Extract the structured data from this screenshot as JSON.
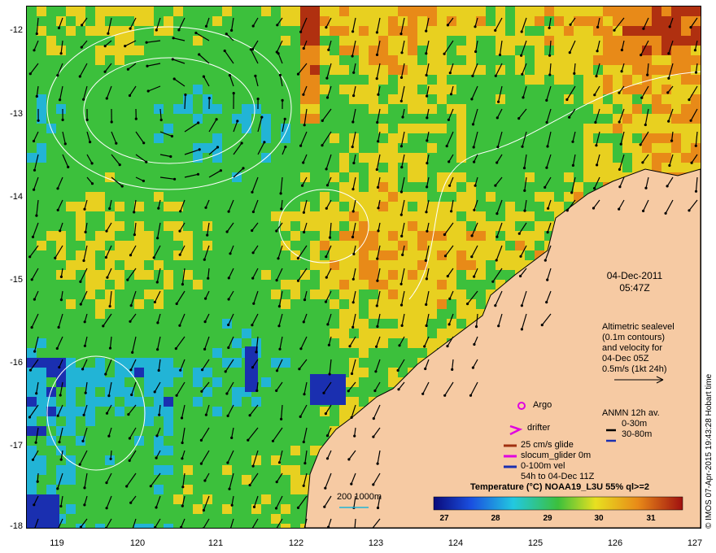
{
  "map": {
    "y_axis_labels": [
      "-12",
      "-13",
      "-14",
      "-15",
      "-16",
      "-17",
      "-18"
    ],
    "x_axis_labels": [
      "119",
      "120",
      "121",
      "122",
      "123",
      "124",
      "125",
      "126",
      "127"
    ],
    "lat_range": [
      -18,
      -12
    ],
    "lon_range": [
      118.6,
      127
    ],
    "colors": {
      "land": "#f6caa3",
      "cold": "#1a2fb0",
      "cool": "#22b4d6",
      "mid": "#3cc03c",
      "warm": "#e8d020",
      "hot": "#e88a18",
      "hottest": "#b03010"
    }
  },
  "date_block": {
    "date": "04-Dec-2011",
    "time": "05:47Z"
  },
  "altimetry": {
    "line1": "Altimetric sealevel",
    "line2": "(0.1m contours)",
    "line3": "and velocity for",
    "line4": "04-Dec 05Z",
    "line5": "0.5m/s (1kt 24h)"
  },
  "anmn": {
    "title": "ANMN 12h av.",
    "row1": "0-30m",
    "row2": "30-80m"
  },
  "legend": {
    "argo": "Argo",
    "drifter": "drifter",
    "glide": "25 cm/s glide",
    "slocum": "slocum_glider 0m",
    "vel": "0-100m vel",
    "span": "54h to 04-Dec 11Z"
  },
  "depth_legend": "200  1000m",
  "colorbar": {
    "title": "Temperature (°C) NOAA19_L3U 55% ql>=2",
    "ticks": [
      "27",
      "28",
      "29",
      "30",
      "31"
    ]
  },
  "credit": "© IMOS 07-Apr-2015 19:43:28 Hobart time"
}
